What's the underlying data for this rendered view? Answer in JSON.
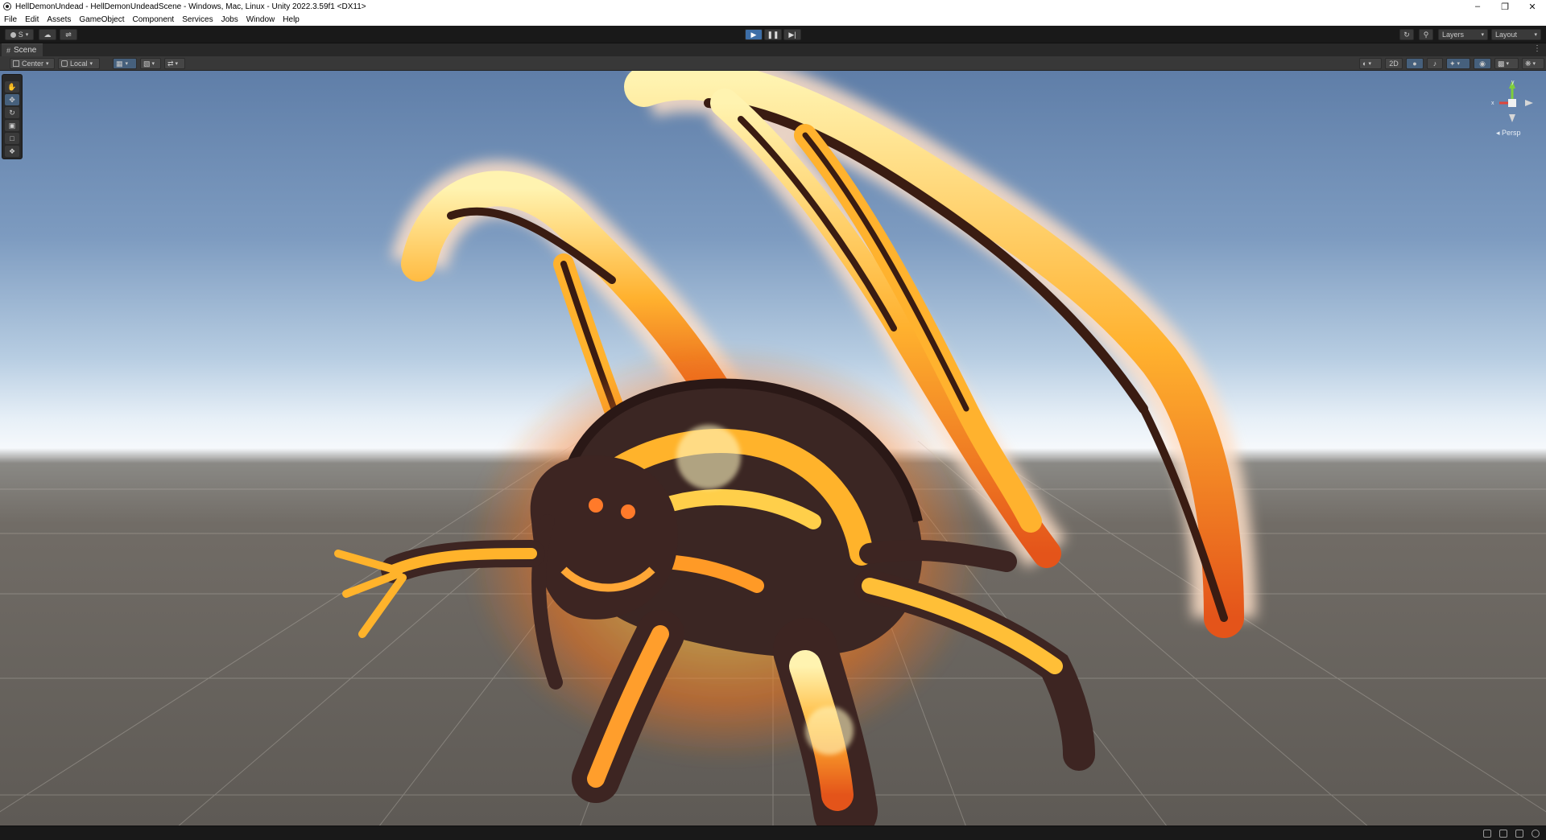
{
  "window": {
    "title": "HellDemonUndead - HellDemonUndeadScene - Windows, Mac, Linux - Unity 2022.3.59f1 <DX11>"
  },
  "menu": [
    "File",
    "Edit",
    "Assets",
    "GameObject",
    "Component",
    "Services",
    "Jobs",
    "Window",
    "Help"
  ],
  "toolbar": {
    "account_label": "S",
    "layers_label": "Layers",
    "layout_label": "Layout"
  },
  "tabs": {
    "scene_label": "Scene"
  },
  "scene_toolbar": {
    "pivot_label": "Center",
    "space_label": "Local",
    "mode_2d_label": "2D"
  },
  "gizmo": {
    "projection_label": "Persp",
    "axis_y_label": "y",
    "axis_x_label": "x"
  },
  "colors": {
    "play_active": "#3d6ea7",
    "editor_dark": "#191919",
    "panel": "#383838"
  }
}
